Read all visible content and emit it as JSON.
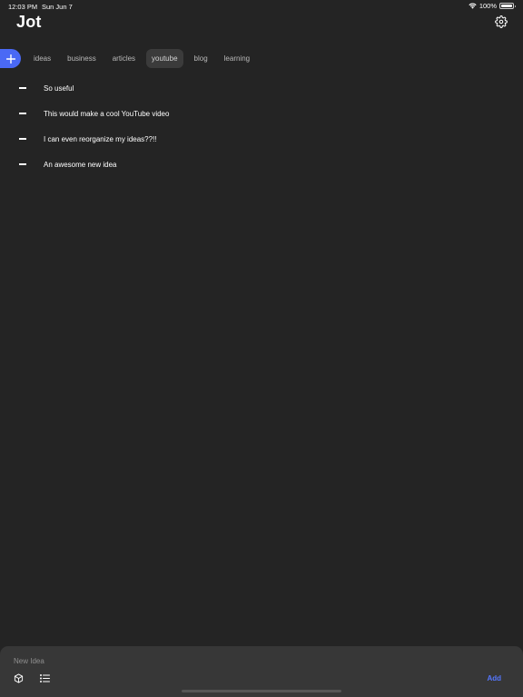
{
  "status_bar": {
    "time": "12:03 PM",
    "date": "Sun Jun 7",
    "battery": "100%",
    "battery_level": 1.0
  },
  "header": {
    "title": "Jot",
    "settings_icon": "gear-icon"
  },
  "tabs": [
    {
      "label": "ideas",
      "active": false
    },
    {
      "label": "business",
      "active": false
    },
    {
      "label": "articles",
      "active": false
    },
    {
      "label": "youtube",
      "active": true
    },
    {
      "label": "blog",
      "active": false
    },
    {
      "label": "learning",
      "active": false
    }
  ],
  "ideas": [
    {
      "text": "So useful"
    },
    {
      "text": "This would make a cool YouTube video"
    },
    {
      "text": "I can even reorganize my ideas??!!"
    },
    {
      "text": "An awesome new idea"
    }
  ],
  "composer": {
    "placeholder": "New Idea",
    "value": "",
    "add_label": "Add"
  },
  "colors": {
    "background": "#242424",
    "accent": "#4a69f5",
    "add_text": "#5577ff",
    "composer_bg": "#373737"
  }
}
